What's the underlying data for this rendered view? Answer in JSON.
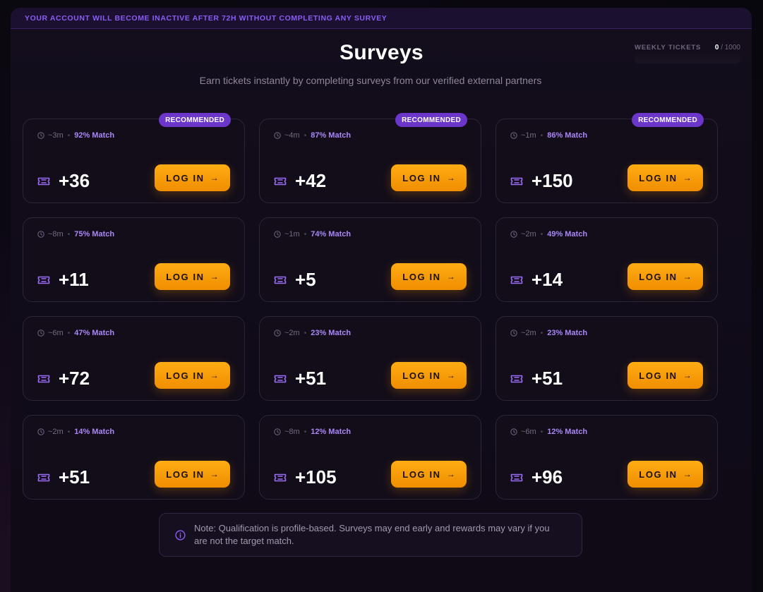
{
  "banner": {
    "text": "YOUR ACCOUNT WILL BECOME INACTIVE AFTER 72H WITHOUT COMPLETING ANY SURVEY"
  },
  "header": {
    "title": "Surveys",
    "subtitle": "Earn tickets instantly by completing surveys from our verified external partners"
  },
  "weekly": {
    "label": "WEEKLY TICKETS",
    "current": "0",
    "max": "/ 1000"
  },
  "colors": {
    "accent": "#8a5cf5",
    "badge": "#6b36c9",
    "button": "#f5a00a",
    "match": "#a987f7"
  },
  "icons": {
    "clock": "clock-icon",
    "ticket": "ticket-icon",
    "arrow": "arrow-right-icon",
    "info": "info-icon"
  },
  "surveys": [
    {
      "time": "~3m",
      "match": "92% Match",
      "reward": "+36",
      "badge": "RECOMMENDED",
      "button": "LOG IN"
    },
    {
      "time": "~4m",
      "match": "87% Match",
      "reward": "+42",
      "badge": "RECOMMENDED",
      "button": "LOG IN"
    },
    {
      "time": "~1m",
      "match": "86% Match",
      "reward": "+150",
      "badge": "RECOMMENDED",
      "button": "LOG IN"
    },
    {
      "time": "~8m",
      "match": "75% Match",
      "reward": "+11",
      "badge": "",
      "button": "LOG IN"
    },
    {
      "time": "~1m",
      "match": "74% Match",
      "reward": "+5",
      "badge": "",
      "button": "LOG IN"
    },
    {
      "time": "~2m",
      "match": "49% Match",
      "reward": "+14",
      "badge": "",
      "button": "LOG IN"
    },
    {
      "time": "~6m",
      "match": "47% Match",
      "reward": "+72",
      "badge": "",
      "button": "LOG IN"
    },
    {
      "time": "~2m",
      "match": "23% Match",
      "reward": "+51",
      "badge": "",
      "button": "LOG IN"
    },
    {
      "time": "~2m",
      "match": "23% Match",
      "reward": "+51",
      "badge": "",
      "button": "LOG IN"
    },
    {
      "time": "~2m",
      "match": "14% Match",
      "reward": "+51",
      "badge": "",
      "button": "LOG IN"
    },
    {
      "time": "~8m",
      "match": "12% Match",
      "reward": "+105",
      "badge": "",
      "button": "LOG IN"
    },
    {
      "time": "~6m",
      "match": "12% Match",
      "reward": "+96",
      "badge": "",
      "button": "LOG IN"
    }
  ],
  "note": {
    "text": "Note: Qualification is profile-based. Surveys may end early and rewards may vary if you are not the target match."
  }
}
